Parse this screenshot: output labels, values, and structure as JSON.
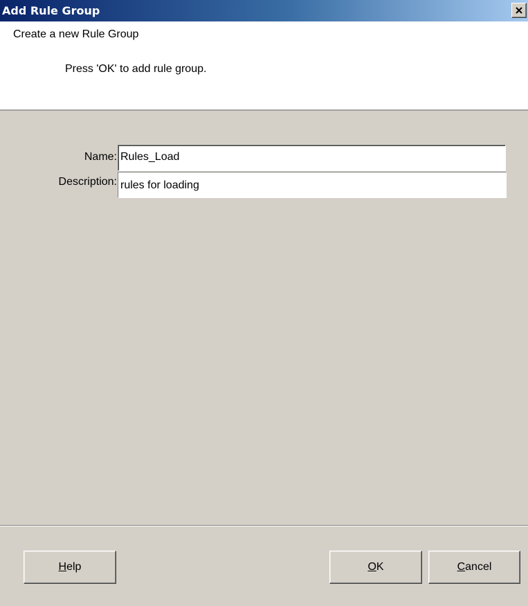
{
  "window": {
    "title": "Add Rule Group",
    "close_glyph": "×"
  },
  "header": {
    "title": "Create a new Rule Group",
    "instruction": "Press 'OK' to add rule group."
  },
  "form": {
    "name_label": "Name:",
    "name_value": "Rules_Load",
    "description_label": "Description:",
    "description_value": "rules for loading"
  },
  "buttons": {
    "help": {
      "mnemonic": "H",
      "rest": "elp"
    },
    "ok": {
      "mnemonic": "O",
      "rest": "K"
    },
    "cancel": {
      "mnemonic": "C",
      "rest": "ancel"
    }
  },
  "colors": {
    "title_gradient_start": "#0a246a",
    "title_gradient_end": "#a6caf0",
    "dialog_background": "#d4d0c8",
    "header_background": "#ffffff"
  }
}
